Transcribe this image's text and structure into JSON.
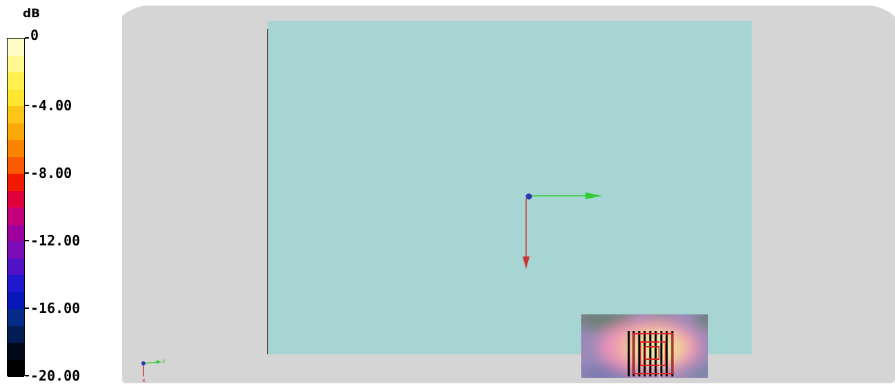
{
  "legend": {
    "unit": "dB",
    "ticks": [
      {
        "label": "0"
      },
      {
        "label": "-4.00"
      },
      {
        "label": "-8.00"
      },
      {
        "label": "-12.00"
      },
      {
        "label": "-16.00"
      },
      {
        "label": "-20.00"
      }
    ],
    "colors": [
      "#fffcc8",
      "#fff790",
      "#fff24e",
      "#fee530",
      "#fdc517",
      "#fba90a",
      "#fb8500",
      "#fb5a00",
      "#f21b00",
      "#e0003c",
      "#c4007a",
      "#9e009e",
      "#7a0cb7",
      "#5012c6",
      "#2018cd",
      "#0818b8",
      "#052a88",
      "#031c55",
      "#01081a",
      "#000000"
    ]
  },
  "scene": {
    "background": "#d5d5d5",
    "plate_color": "#a6d5d4",
    "edge_color": "#555555",
    "axis_colors": {
      "y": "#33cc33",
      "x": "#cc3333",
      "origin": "#2a3aa8"
    },
    "triad_labels": {
      "y": "y",
      "x": "x"
    },
    "heatmap_colors": [
      "#6b7f78",
      "#a08ec0",
      "#e48fb0",
      "#f1b2a0",
      "#f0d89a",
      "#e0e8a0"
    ]
  }
}
